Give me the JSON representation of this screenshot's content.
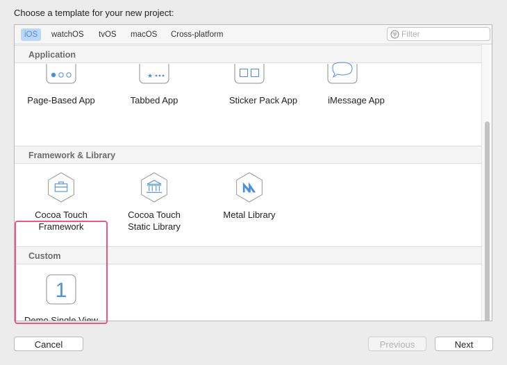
{
  "dialog": {
    "heading": "Choose a template for your new project:"
  },
  "platform_tabs": [
    {
      "label": "iOS",
      "selected": true
    },
    {
      "label": "watchOS",
      "selected": false
    },
    {
      "label": "tvOS",
      "selected": false
    },
    {
      "label": "macOS",
      "selected": false
    },
    {
      "label": "Cross-platform",
      "selected": false
    }
  ],
  "filter": {
    "placeholder": "Filter",
    "value": "",
    "icon": "filter-icon"
  },
  "sections": [
    {
      "title": "Application",
      "templates": [
        {
          "label": "Page-Based App",
          "icon": "page-based-app-icon"
        },
        {
          "label": "Tabbed App",
          "icon": "tabbed-app-icon"
        },
        {
          "label": "Sticker Pack App",
          "icon": "sticker-pack-app-icon"
        },
        {
          "label": "iMessage App",
          "icon": "imessage-app-icon"
        }
      ]
    },
    {
      "title": "Framework & Library",
      "templates": [
        {
          "label": "Cocoa Touch\nFramework",
          "icon": "framework-toolbox-icon"
        },
        {
          "label": "Cocoa Touch\nStatic Library",
          "icon": "static-library-building-icon"
        },
        {
          "label": "Metal Library",
          "icon": "metal-library-icon"
        }
      ]
    },
    {
      "title": "Custom",
      "templates": [
        {
          "label": "Demo Single View\nApp",
          "icon": "number-one-icon",
          "icon_text": "1",
          "selected": true
        }
      ]
    }
  ],
  "buttons": {
    "cancel": "Cancel",
    "previous": "Previous",
    "next": "Next"
  },
  "colors": {
    "accent": "#4a8fe0",
    "highlight": "#e8598a",
    "tab_selected_bg": "#bcd6f5"
  }
}
